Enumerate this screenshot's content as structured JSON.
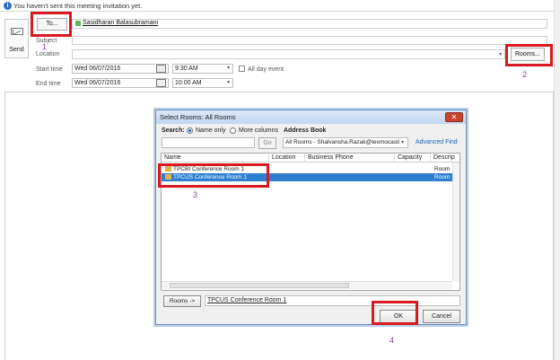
{
  "info": {
    "text": "You haven't sent this meeting invitation yet."
  },
  "send": {
    "label": "Send"
  },
  "form": {
    "to_label": "To...",
    "to_value": "Sasidharan Balasubramani",
    "subject_label": "Subject",
    "location_label": "Location",
    "start_label": "Start time",
    "start_date": "Wed 06/07/2016",
    "start_time": "9:30 AM",
    "all_day": "All day event",
    "end_label": "End time",
    "end_date": "Wed 06/07/2016",
    "end_time": "10:00 AM",
    "rooms_label": "Rooms..."
  },
  "annotations": {
    "n1": "1",
    "n2": "2",
    "n3": "3",
    "n4": "4"
  },
  "dialog": {
    "title": "Select Rooms: All Rooms",
    "search_label": "Search:",
    "name_only": "Name only",
    "more_columns": "More columns",
    "address_book": "Address Book",
    "go": "Go",
    "address_value": "All Rooms - Shalvansha.Razak@texmocasti",
    "advanced_find": "Advanced Find",
    "columns": [
      "Name",
      "Location",
      "Business Phone",
      "Capacity",
      "Descrip"
    ],
    "rows": [
      {
        "name": "TPCBI Conference Room 1",
        "desc": "Room"
      },
      {
        "name": "TPCUS Conference Room 1",
        "desc": "Room"
      }
    ],
    "rooms_btn": "Rooms ->",
    "rooms_value": "TPCUS Conference Room 1",
    "ok": "OK",
    "cancel": "Cancel"
  }
}
